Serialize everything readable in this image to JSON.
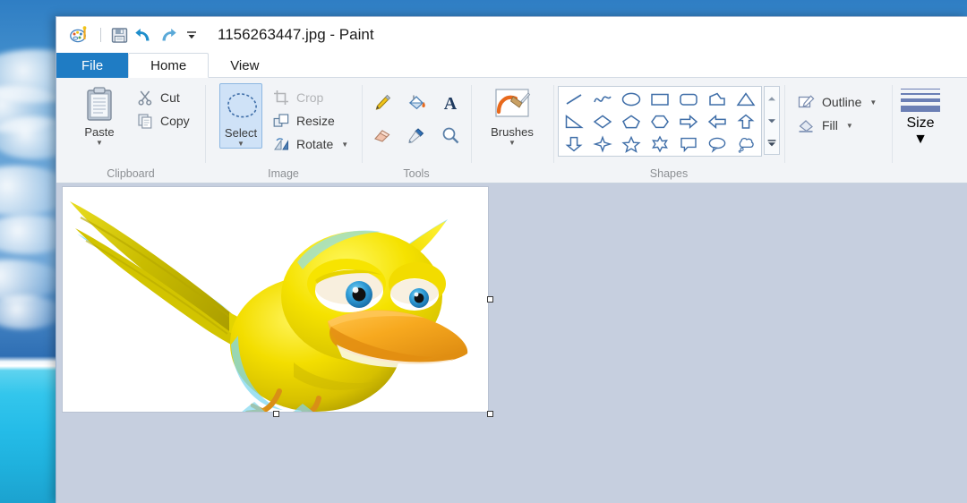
{
  "window": {
    "title": "1156263447.jpg - Paint",
    "app_name": "Paint",
    "file_name": "1156263447.jpg"
  },
  "quick_access": [
    {
      "name": "paint-logo-icon",
      "label": "Paint"
    },
    {
      "name": "save-icon",
      "label": "Save"
    },
    {
      "name": "undo-icon",
      "label": "Undo"
    },
    {
      "name": "redo-icon",
      "label": "Redo"
    },
    {
      "name": "customize-quick-access-icon",
      "label": "Customize Quick Access Toolbar"
    }
  ],
  "tabs": [
    {
      "label": "File",
      "active": false,
      "style": "file"
    },
    {
      "label": "Home",
      "active": true,
      "style": "normal"
    },
    {
      "label": "View",
      "active": false,
      "style": "normal"
    }
  ],
  "ribbon": {
    "groups": [
      {
        "label": "Clipboard",
        "big": {
          "label": "Paste",
          "icon": "clipboard-icon",
          "has_caret": true
        },
        "items": [
          {
            "label": "Cut",
            "icon": "scissors-icon",
            "disabled": false
          },
          {
            "label": "Copy",
            "icon": "copy-icon",
            "disabled": false
          }
        ]
      },
      {
        "label": "Image",
        "big": {
          "label": "Select",
          "icon": "free-form-select-icon",
          "has_caret": true,
          "selected": true
        },
        "items": [
          {
            "label": "Crop",
            "icon": "crop-icon",
            "disabled": true
          },
          {
            "label": "Resize",
            "icon": "resize-icon",
            "disabled": false
          },
          {
            "label": "Rotate",
            "icon": "rotate-icon",
            "disabled": false,
            "has_caret": true
          }
        ]
      },
      {
        "label": "Tools",
        "tools": [
          {
            "name": "pencil-icon",
            "label": "Pencil"
          },
          {
            "name": "fill-with-color-icon",
            "label": "Fill with color"
          },
          {
            "name": "text-icon",
            "label": "Text"
          },
          {
            "name": "eraser-icon",
            "label": "Eraser"
          },
          {
            "name": "color-picker-icon",
            "label": "Color picker"
          },
          {
            "name": "magnifier-icon",
            "label": "Magnifier"
          }
        ]
      },
      {
        "label": "",
        "big": {
          "label": "Brushes",
          "icon": "brushes-icon",
          "has_caret": true
        }
      },
      {
        "label": "Shapes",
        "shapes": [
          "line-shape",
          "curve-shape",
          "oval-shape",
          "rectangle-shape",
          "rounded-rectangle-shape",
          "polygon-shape",
          "triangle-shape",
          "right-triangle-shape",
          "diamond-shape",
          "pentagon-shape",
          "hexagon-shape",
          "right-arrow-shape",
          "left-arrow-shape",
          "up-arrow-shape",
          "down-arrow-shape",
          "four-point-star-shape",
          "five-point-star-shape",
          "six-point-star-shape",
          "rounded-callout-shape",
          "oval-callout-shape",
          "cloud-callout-shape"
        ],
        "scroll_buttons": [
          "scroll-up-icon",
          "scroll-down-icon",
          "more-shapes-icon"
        ]
      },
      {
        "label": "",
        "items": [
          {
            "label": "Outline",
            "icon": "outline-icon",
            "has_caret": true
          },
          {
            "label": "Fill",
            "icon": "fill-icon",
            "has_caret": true
          }
        ]
      },
      {
        "label": "",
        "size": {
          "label": "Size",
          "icon": "size-icon",
          "has_caret": true,
          "thicknesses": [
            1,
            2,
            4,
            7
          ]
        }
      }
    ]
  },
  "canvas": {
    "image_alt": "Cartoon yellow bird flying with outstretched wings",
    "selected": true,
    "handles": [
      "right-middle",
      "bottom-middle",
      "bottom-right"
    ],
    "colors": {
      "body_yellow": "#F2DE00",
      "wing_olive": "#C6B800",
      "beak_orange": "#F5A623",
      "eye_iris": "#2E9BD6",
      "feet_orange": "#E08E1C",
      "canvas_background": "#C6CFDF"
    }
  },
  "desktop": {
    "wallpaper_description": "Blue sky with clouds over turquoise sea",
    "colors": {
      "sky": "#2F7EC4",
      "sea": "#29C0EA",
      "beach": "#FFFFFF"
    }
  }
}
